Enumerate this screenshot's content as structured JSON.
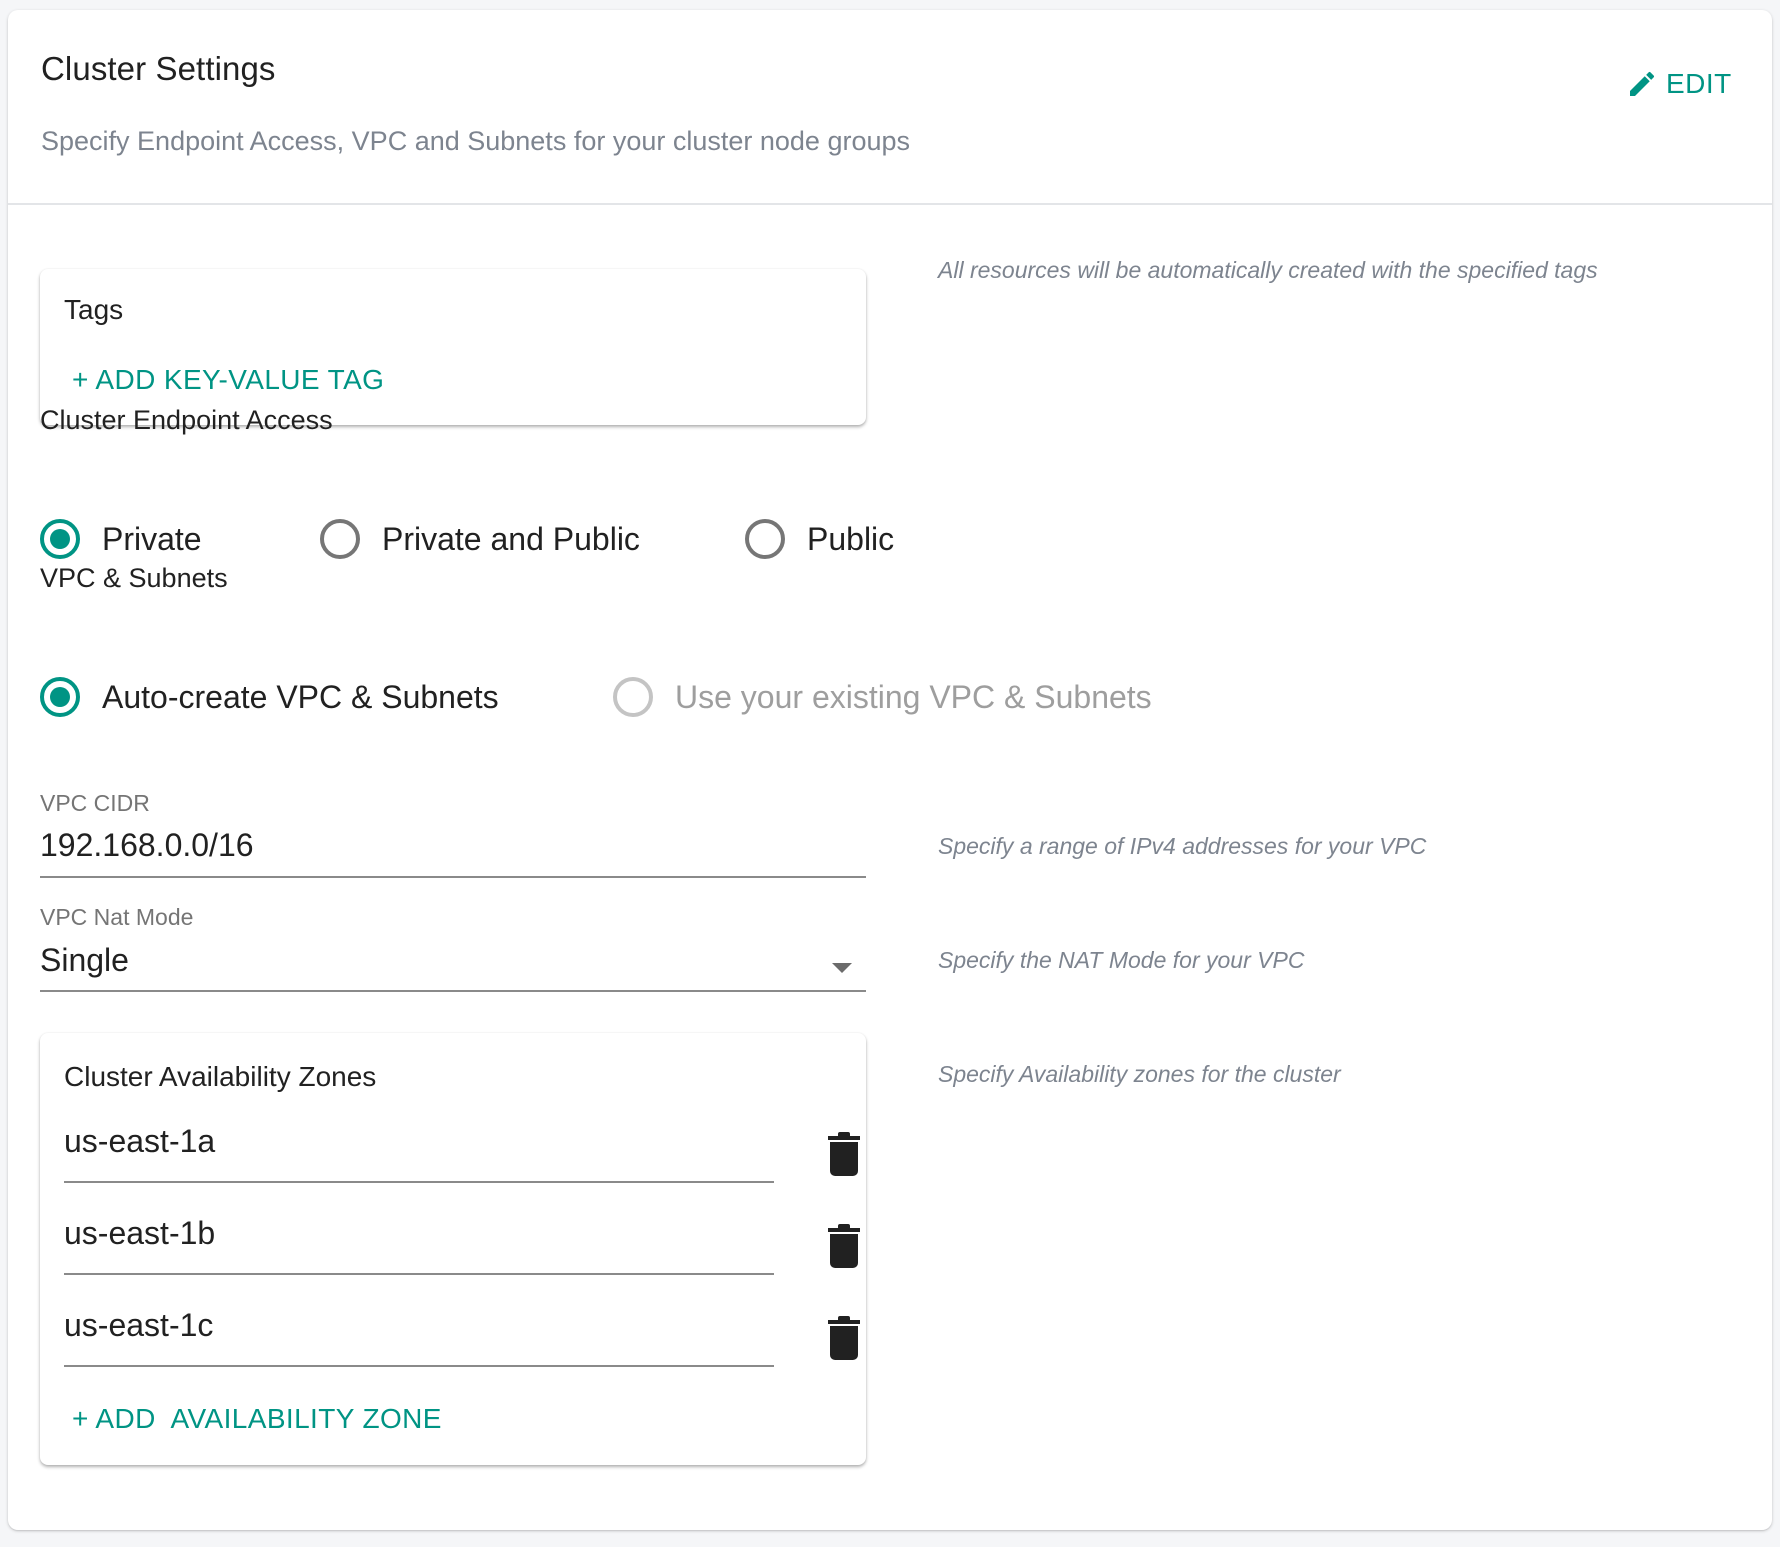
{
  "header": {
    "title": "Cluster Settings",
    "subtitle": "Specify Endpoint Access, VPC and Subnets for your cluster node groups",
    "edit_label": "EDIT",
    "edit_icon": "pencil-icon"
  },
  "tags": {
    "title": "Tags",
    "add_label": "+ ADD KEY-VALUE TAG",
    "help": "All resources will be automatically created with the specified tags"
  },
  "endpoint_access": {
    "label": "Cluster Endpoint Access",
    "options": [
      {
        "label": "Private",
        "checked": true
      },
      {
        "label": "Private and Public",
        "checked": false
      },
      {
        "label": "Public",
        "checked": false
      }
    ]
  },
  "vpc_subnets": {
    "label": "VPC & Subnets",
    "options": [
      {
        "label": "Auto-create VPC & Subnets",
        "checked": true
      },
      {
        "label": "Use your existing VPC & Subnets",
        "checked": false,
        "disabled": true
      }
    ]
  },
  "vpc_cidr": {
    "label": "VPC CIDR",
    "value": "192.168.0.0/16",
    "help": "Specify a range of IPv4 addresses for your VPC"
  },
  "nat_mode": {
    "label": "VPC Nat Mode",
    "value": "Single",
    "help": "Specify the NAT Mode for your VPC"
  },
  "availability_zones": {
    "title": "Cluster Availability Zones",
    "help": "Specify Availability zones for the cluster",
    "zones": [
      "us-east-1a",
      "us-east-1b",
      "us-east-1c"
    ],
    "add_label": "+ ADD  AVAILABILITY ZONE"
  },
  "colors": {
    "accent": "#009484",
    "help_text": "#7d848f",
    "text": "#212121"
  }
}
